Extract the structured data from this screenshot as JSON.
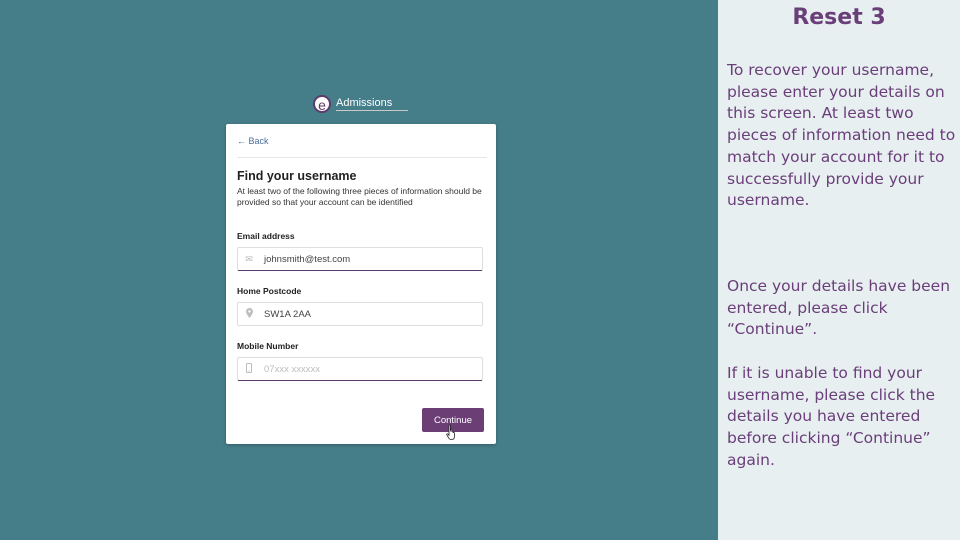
{
  "slide": {
    "heading": "Reset 3",
    "paragraphs": [
      "To recover your username, please enter your details on this screen. At least two pieces of information need to match your account for it to successfully provide your username.",
      "Once your details have been entered, please click “Continue”.",
      "If it is unable to find your username, please click the details you have entered before clicking “Continue” again."
    ]
  },
  "app": {
    "logo_letter": "e",
    "logo_text": "Admissions"
  },
  "form": {
    "back_label": "← Back",
    "title": "Find your username",
    "subtitle": "At least two of the following three pieces of information should be provided so that your account can be identified",
    "fields": [
      {
        "label": "Email address",
        "value": "johnsmith@test.com",
        "placeholder": "",
        "icon": "mail-icon"
      },
      {
        "label": "Home Postcode",
        "value": "SW1A 2AA",
        "placeholder": "",
        "icon": "location-pin-icon"
      },
      {
        "label": "Mobile Number",
        "value": "",
        "placeholder": "07xxx xxxxxx",
        "icon": "phone-icon"
      }
    ],
    "continue_label": "Continue"
  },
  "colors": {
    "background": "#457d88",
    "accent": "#6b3f76",
    "panel": "#e7eff1"
  }
}
